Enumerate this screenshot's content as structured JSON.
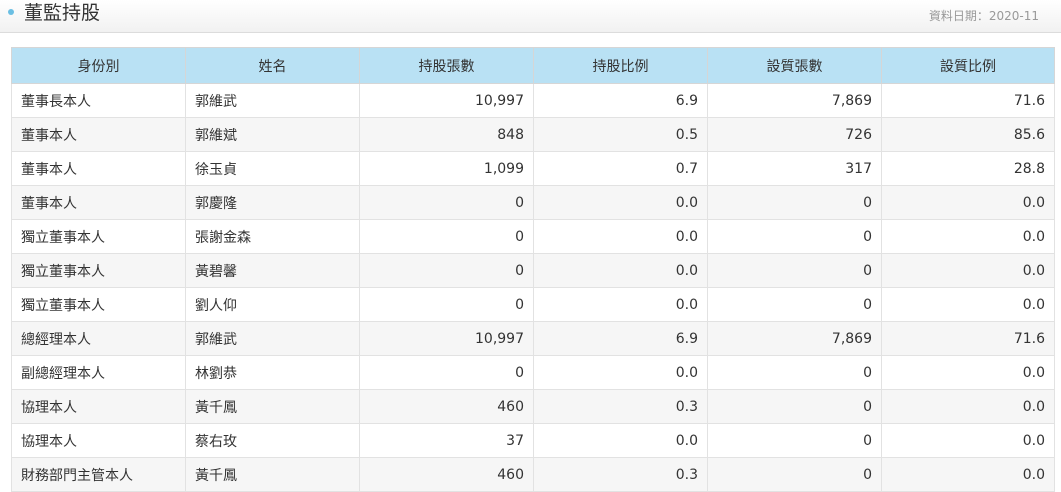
{
  "panel": {
    "title": "董監持股",
    "date_label": "資料日期：2020-11"
  },
  "table": {
    "headers": [
      "身份別",
      "姓名",
      "持股張數",
      "持股比例",
      "設質張數",
      "設質比例"
    ],
    "rows": [
      [
        "董事長本人",
        "郭維武",
        "10,997",
        "6.9",
        "7,869",
        "71.6"
      ],
      [
        "董事本人",
        "郭維斌",
        "848",
        "0.5",
        "726",
        "85.6"
      ],
      [
        "董事本人",
        "徐玉貞",
        "1,099",
        "0.7",
        "317",
        "28.8"
      ],
      [
        "董事本人",
        "郭慶隆",
        "0",
        "0.0",
        "0",
        "0.0"
      ],
      [
        "獨立董事本人",
        "張謝金森",
        "0",
        "0.0",
        "0",
        "0.0"
      ],
      [
        "獨立董事本人",
        "黃碧馨",
        "0",
        "0.0",
        "0",
        "0.0"
      ],
      [
        "獨立董事本人",
        "劉人仰",
        "0",
        "0.0",
        "0",
        "0.0"
      ],
      [
        "總經理本人",
        "郭維武",
        "10,997",
        "6.9",
        "7,869",
        "71.6"
      ],
      [
        "副總經理本人",
        "林劉恭",
        "0",
        "0.0",
        "0",
        "0.0"
      ],
      [
        "協理本人",
        "黃千鳳",
        "460",
        "0.3",
        "0",
        "0.0"
      ],
      [
        "協理本人",
        "蔡右玫",
        "37",
        "0.0",
        "0",
        "0.0"
      ],
      [
        "財務部門主管本人",
        "黃千鳳",
        "460",
        "0.3",
        "0",
        "0.0"
      ]
    ]
  }
}
